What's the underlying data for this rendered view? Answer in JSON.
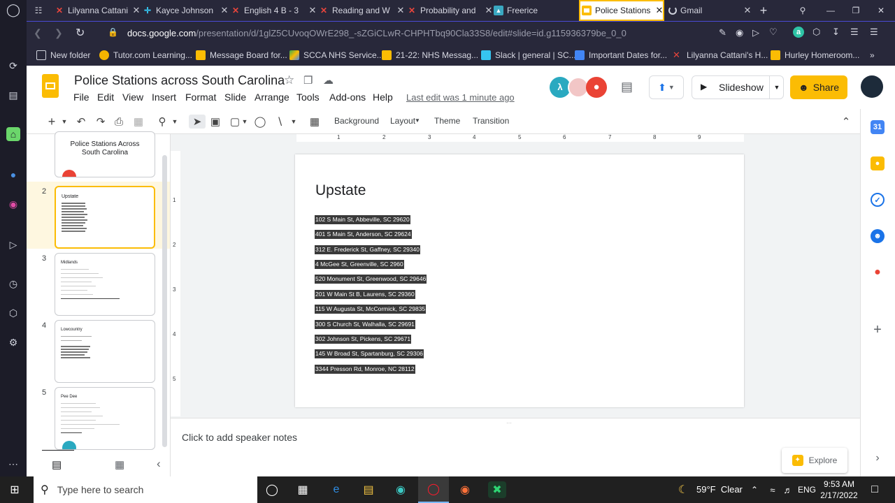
{
  "browser": {
    "tabs": [
      {
        "title": "Lilyanna Cattani",
        "icon": "x-logo-icon",
        "color": "#e8453c",
        "active": false
      },
      {
        "title": "Kayce Johnson",
        "icon": "slack-icon",
        "color": "#36c5f0",
        "active": false
      },
      {
        "title": "English 4 B - 3",
        "icon": "x-logo-icon",
        "color": "#e8453c",
        "active": false
      },
      {
        "title": "Reading and W",
        "icon": "x-logo-icon",
        "color": "#e8453c",
        "active": false
      },
      {
        "title": "Probability and",
        "icon": "x-logo-icon",
        "color": "#e8453c",
        "active": false
      },
      {
        "title": "Freerice",
        "icon": "freerice-icon",
        "color": "#3aa8c1",
        "active": false
      },
      {
        "title": "Police Stations",
        "icon": "slides-icon",
        "color": "#fbbc04",
        "active": true
      },
      {
        "title": "Gmail",
        "icon": "loading-icon",
        "color": "#cfd2dc",
        "active": false
      }
    ],
    "url_prefix": "docs.google.com",
    "url_rest": "/presentation/d/1glZ5CUvoqOWrE298_-sZGiCLwR-CHPHTbq90Cla33S8/edit#slide=id.g115936379be_0_0",
    "bookmarks": [
      {
        "label": "New folder",
        "color": "#cfd2dc"
      },
      {
        "label": "Tutor.com Learning...",
        "color": "#f4b400"
      },
      {
        "label": "Message Board for...",
        "color": "#fbbc04"
      },
      {
        "label": "SCCA NHS Service...",
        "color": "#34a853"
      },
      {
        "label": "21-22: NHS Messag...",
        "color": "#fbbc04"
      },
      {
        "label": "Slack | general | SC...",
        "color": "#36c5f0"
      },
      {
        "label": "Important Dates for...",
        "color": "#4285f4"
      },
      {
        "label": "Lilyanna Cattani's H...",
        "color": "#e8453c"
      },
      {
        "label": "Hurley Homeroom...",
        "color": "#fbbc04"
      }
    ]
  },
  "doc": {
    "title": "Police Stations across South Carolina",
    "menus": [
      "File",
      "Edit",
      "View",
      "Insert",
      "Format",
      "Slide",
      "Arrange",
      "Tools",
      "Add-ons",
      "Help"
    ],
    "last_edit": "Last edit was 1 minute ago",
    "slideshow_label": "Slideshow",
    "share_label": "Share"
  },
  "toolbar": {
    "background": "Background",
    "layout": "Layout",
    "theme": "Theme",
    "transition": "Transition"
  },
  "ruler_marks": [
    "1",
    "2",
    "3",
    "4",
    "5",
    "6",
    "7",
    "8",
    "9"
  ],
  "vruler_marks": [
    "1",
    "2",
    "3",
    "4",
    "5"
  ],
  "filmstrip": [
    {
      "num": "",
      "title": "Police Stations Across South Carolina"
    },
    {
      "num": "2",
      "title": "Upstate"
    },
    {
      "num": "3",
      "title": "Midlands"
    },
    {
      "num": "4",
      "title": "Lowcountry"
    },
    {
      "num": "5",
      "title": "Pee Dee"
    }
  ],
  "slide": {
    "title": "Upstate",
    "addresses": [
      "102 S Main St, Abbeville, SC 29620",
      "401 S Main St, Anderson, SC 29624",
      " 312 E. Frederick St, Gaffney, SC 29340",
      "4 McGee St, Greenville, SC 2960",
      "520 Monument St, Greenwood, SC 29646",
      "201 W Main St B, Laurens, SC 29360",
      "115 W Augusta St, McCormick, SC 29835",
      " 300 S Church St, Walhalla, SC 29691",
      "302 Johnson St, Pickens, SC 29671",
      "145 W Broad St, Spartanburg, SC 29306",
      "3344 Presson Rd, Monroe, NC 28112"
    ]
  },
  "notes_placeholder": "Click to add speaker notes",
  "explore_label": "Explore",
  "taskbar": {
    "search_placeholder": "Type here to search",
    "weather": "59°F  Clear",
    "lang": "ENG",
    "time": "9:53 AM",
    "date": "2/17/2022"
  }
}
